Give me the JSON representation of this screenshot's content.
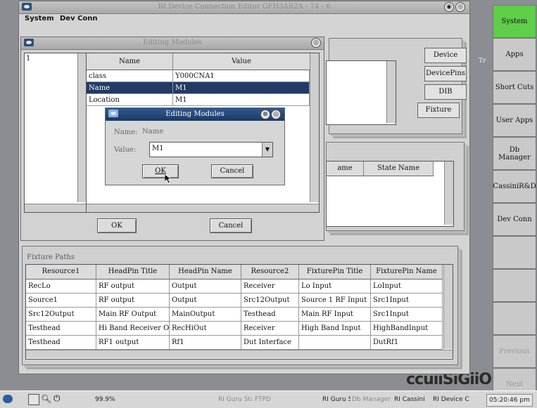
{
  "main_window": {
    "title": "RI Device Connection Editor GFH3AR2A - 74 - 6",
    "menu": [
      "System",
      "Dev Conn"
    ]
  },
  "editing_modules": {
    "title": "Editing Modules",
    "list_item": "1",
    "headers": [
      "Name",
      "Value"
    ],
    "rows": [
      {
        "name": "class",
        "value": "Y000CNA1"
      },
      {
        "name": "Name",
        "value": "M1"
      },
      {
        "name": "Location",
        "value": "M1"
      }
    ],
    "ok_label": "OK",
    "cancel_label": "Cancel"
  },
  "dialog": {
    "title": "Editing Modules",
    "name_label": "Name:",
    "name_value": "Name",
    "value_label": "Value:",
    "value_input": "M1",
    "ok_label": "OK",
    "cancel_label": "Cancel"
  },
  "tabs": [
    "Device",
    "DevicePins",
    "DIB",
    "Fixture"
  ],
  "state_headers": [
    "ame",
    "State Name"
  ],
  "fixture_paths": {
    "title": "Fixture Paths",
    "headers": [
      "Resource1",
      "HeadPin Title",
      "HeadPin Name",
      "Resource2",
      "FixturePin Title",
      "FixturePin Name"
    ],
    "rows": [
      [
        "RecLo",
        "RF output",
        "Output",
        "Receiver",
        "Lo Input",
        "LoInput"
      ],
      [
        "Source1",
        "RF output",
        "Output",
        "Src12Output",
        "Source 1 RF Input",
        "Src1Input"
      ],
      [
        "Src12Output",
        "Main RF Output",
        "MainOutput",
        "Testhead",
        "Main RF Input",
        "Src1Input"
      ],
      [
        "Testhead",
        "Hi Band Receiver Out",
        "RecHiOut",
        "Receiver",
        "High Band Input",
        "HighBandInput"
      ],
      [
        "Testhead",
        "RF1 output",
        "Rf1",
        "Dut Interface",
        "",
        "DutRf1"
      ]
    ]
  },
  "sidebar": [
    {
      "label": "System",
      "state": "active"
    },
    {
      "label": "Apps",
      "state": "normal"
    },
    {
      "label": "Short Cuts",
      "state": "normal"
    },
    {
      "label": "User Apps",
      "state": "normal"
    },
    {
      "label": "Db Manager",
      "state": "normal"
    },
    {
      "label": "CassiniR&D",
      "state": "normal"
    },
    {
      "label": "Dev Conn",
      "state": "normal"
    },
    {
      "label": "",
      "state": "empty"
    },
    {
      "label": "",
      "state": "empty"
    },
    {
      "label": "",
      "state": "empty"
    },
    {
      "label": "Previous",
      "state": "disabled"
    },
    {
      "label": "Next",
      "state": "disabled"
    }
  ],
  "background_text": {
    "logo": "ccuiiSiGiiOii",
    "tr": "Tr"
  },
  "taskbar": {
    "zoom": "99.9%",
    "items": [
      "RI Guru Sta",
      "FTPD",
      "RI Guru Se",
      "Db Manager -",
      "RI Cassini",
      "RI Device C"
    ],
    "clock": "05:20:46 pm"
  },
  "colors": {
    "selected_row": "#233a66",
    "active_sidebar": "#5fce4a",
    "window_bg": "#d4d4d4"
  }
}
